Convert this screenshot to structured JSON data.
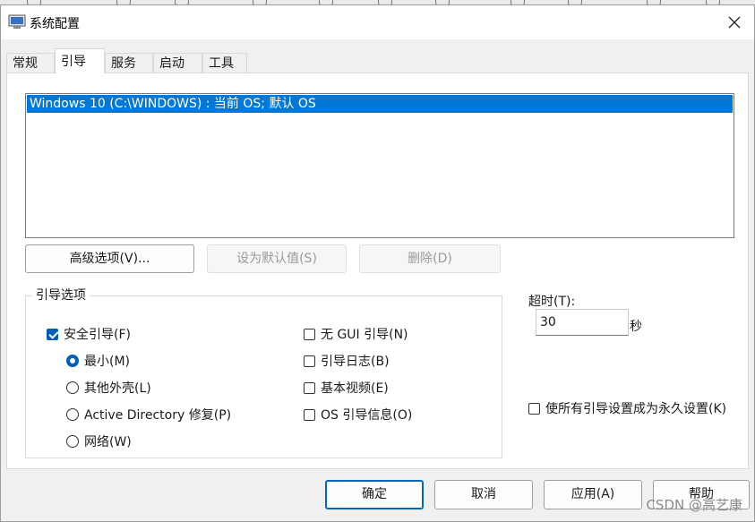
{
  "window": {
    "title": "系统配置"
  },
  "tabs": [
    {
      "label": "常规"
    },
    {
      "label": "引导"
    },
    {
      "label": "服务"
    },
    {
      "label": "启动"
    },
    {
      "label": "工具"
    }
  ],
  "os_list": {
    "items": [
      "Windows 10 (C:\\WINDOWS) : 当前 OS; 默认 OS"
    ]
  },
  "list_buttons": {
    "advanced": "高级选项(V)...",
    "set_default": "设为默认值(S)",
    "delete": "删除(D)"
  },
  "boot_options": {
    "group_label": "引导选项",
    "safe_boot": "安全引导(F)",
    "minimal": "最小(M)",
    "alternate_shell": "其他外壳(L)",
    "active_directory": "Active Directory 修复(P)",
    "network": "网络(W)",
    "no_gui": "无 GUI 引导(N)",
    "boot_log": "引导日志(B)",
    "base_video": "基本视频(E)",
    "os_boot_info": "OS 引导信息(O)"
  },
  "timeout": {
    "label": "超时(T):",
    "value": "30",
    "unit": "秒"
  },
  "permanent": "使所有引导设置成为永久设置(K)",
  "footer": {
    "ok": "确定",
    "cancel": "取消",
    "apply": "应用(A)",
    "help": "帮助"
  },
  "watermark": "CSDN @高艺康",
  "colors": {
    "selection": "#0078d7",
    "accent": "#005fb8"
  }
}
